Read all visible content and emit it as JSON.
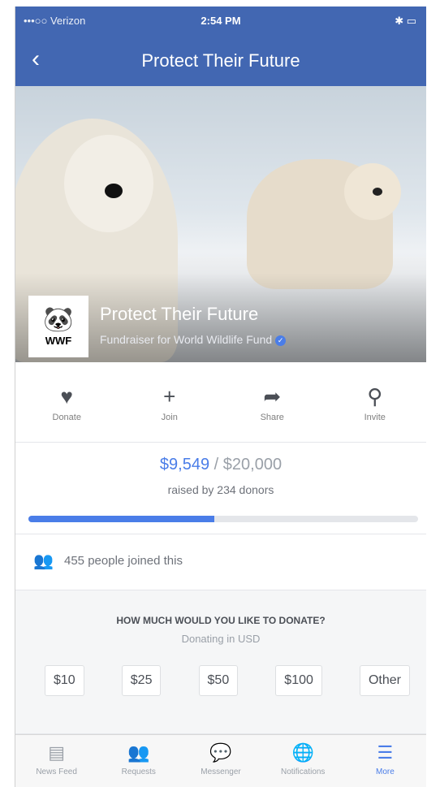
{
  "status_bar": {
    "carrier": "•••○○ Verizon",
    "time": "2:54 PM",
    "indicators": "✱ ▭"
  },
  "nav": {
    "back_icon": "chevron-left-icon",
    "title": "Protect Their Future"
  },
  "hero": {
    "title": "Protect Their Future",
    "subtitle": "Fundraiser for World Wildlife Fund",
    "logo_text": "WWF"
  },
  "actions": [
    {
      "label": "Donate",
      "icon": "heart-icon",
      "glyph": "♥"
    },
    {
      "label": "Join",
      "icon": "plus-icon",
      "glyph": "+"
    },
    {
      "label": "Share",
      "icon": "share-arrow-icon",
      "glyph": "➦"
    },
    {
      "label": "Invite",
      "icon": "invite-person-icon",
      "glyph": "⚲"
    }
  ],
  "fundraiser": {
    "raised": "$9,549",
    "goal": "/ $20,000",
    "donors_text": "raised by 234 donors",
    "progress_fraction": 0.4775,
    "accent_color": "#4a7de8"
  },
  "joined_text": "455 people joined this",
  "donate_section": {
    "question": "HOW MUCH WOULD YOU LIKE TO DONATE?",
    "currency_note": "Donating in USD",
    "amounts": [
      "$10",
      "$25",
      "$50",
      "$100",
      "Other"
    ]
  },
  "tabs": [
    {
      "label": "News Feed",
      "icon": "news-feed-icon",
      "glyph": "▤"
    },
    {
      "label": "Requests",
      "icon": "friend-requests-icon",
      "glyph": "👥"
    },
    {
      "label": "Messenger",
      "icon": "messenger-icon",
      "glyph": "💬"
    },
    {
      "label": "Notifications",
      "icon": "globe-icon",
      "glyph": "🌐"
    },
    {
      "label": "More",
      "icon": "menu-icon",
      "glyph": "☰"
    }
  ]
}
